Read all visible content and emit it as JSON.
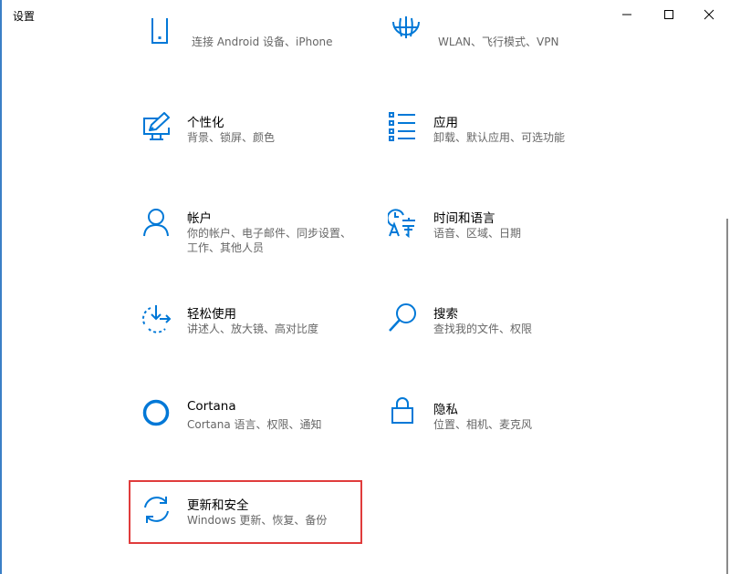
{
  "window": {
    "title": "设置",
    "controls": [
      "minimize-icon",
      "maximize-icon",
      "close-icon"
    ]
  },
  "accent_color": "#0078d7",
  "highlight_color": "#e03c3c",
  "tiles": {
    "phone": {
      "name": "",
      "desc": "连接 Android 设备、iPhone",
      "icon": "phone-icon"
    },
    "network": {
      "name": "",
      "desc": "WLAN、飞行模式、VPN",
      "icon": "globe-icon"
    },
    "personalization": {
      "name": "个性化",
      "desc": "背景、锁屏、颜色",
      "icon": "personalization-icon"
    },
    "apps": {
      "name": "应用",
      "desc": "卸载、默认应用、可选功能",
      "icon": "apps-list-icon"
    },
    "accounts": {
      "name": "帐户",
      "desc": "你的帐户、电子邮件、同步设置、工作、其他人员",
      "icon": "person-icon"
    },
    "time_language": {
      "name": "时间和语言",
      "desc": "语音、区域、日期",
      "icon": "time-language-icon"
    },
    "ease_of_access": {
      "name": "轻松使用",
      "desc": "讲述人、放大镜、高对比度",
      "icon": "ease-of-access-icon"
    },
    "search": {
      "name": "搜索",
      "desc": "查找我的文件、权限",
      "icon": "search-icon"
    },
    "cortana": {
      "name": "Cortana",
      "desc": "Cortana 语言、权限、通知",
      "icon": "cortana-icon"
    },
    "privacy": {
      "name": "隐私",
      "desc": "位置、相机、麦克风",
      "icon": "lock-icon"
    },
    "update_security": {
      "name": "更新和安全",
      "desc": "Windows 更新、恢复、备份",
      "icon": "sync-icon"
    }
  }
}
